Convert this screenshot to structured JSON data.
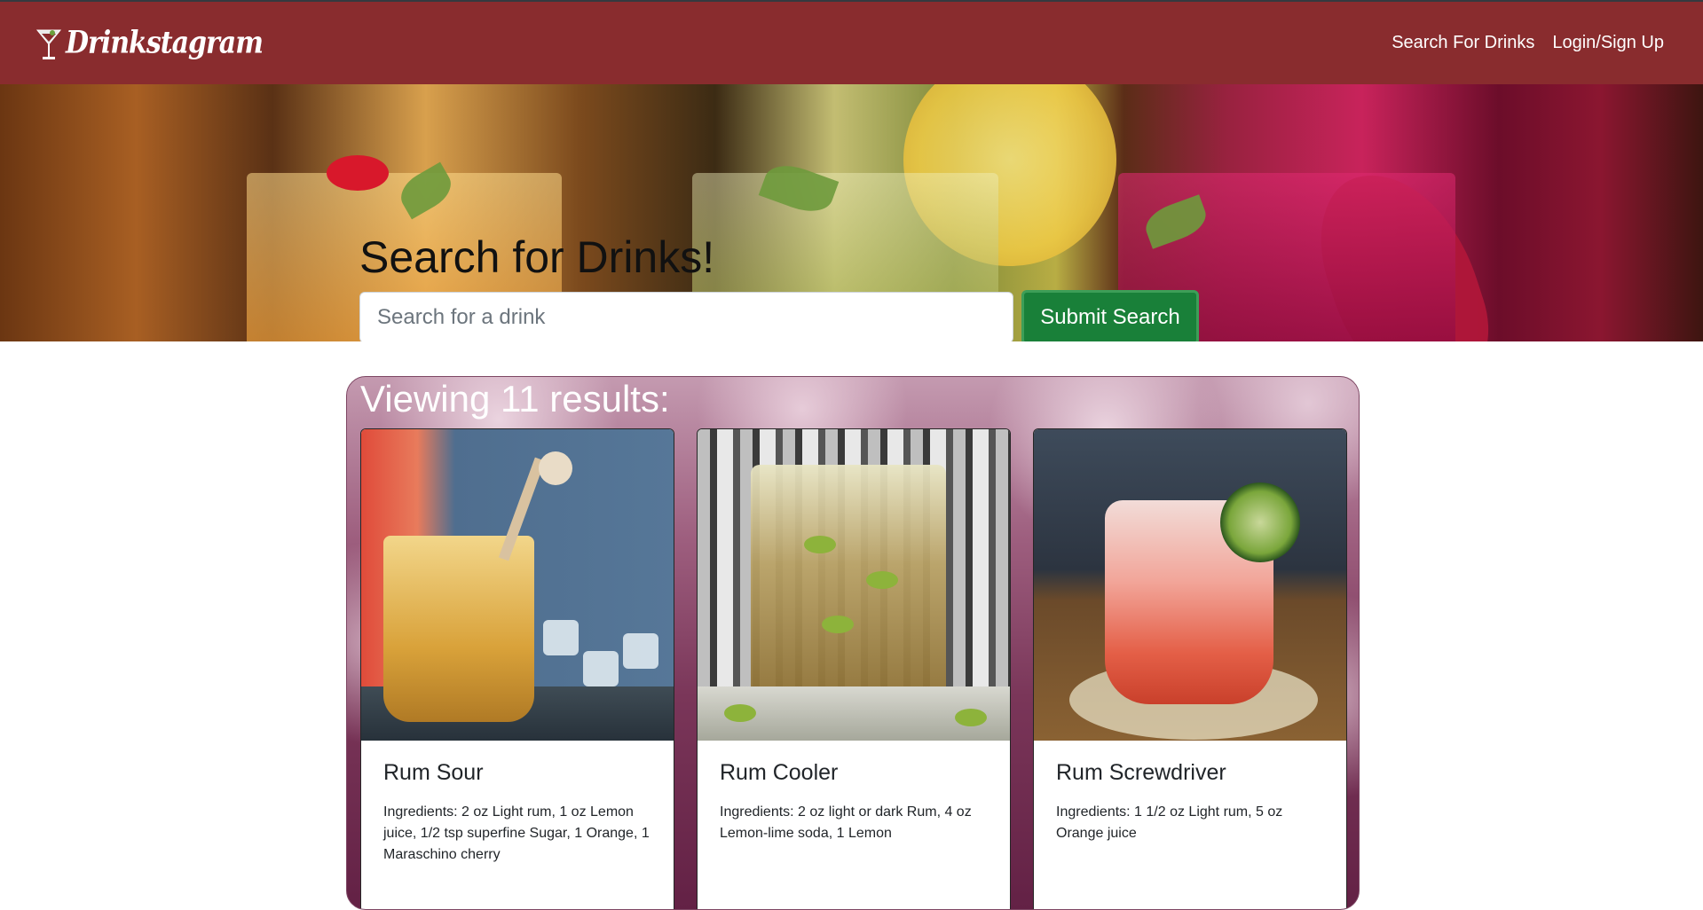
{
  "navbar": {
    "brand": "Drinkstagram",
    "links": [
      "Search For Drinks",
      "Login/Sign Up"
    ]
  },
  "search": {
    "title": "Search for Drinks!",
    "placeholder": "Search for a drink",
    "button": "Submit Search"
  },
  "results": {
    "title": "Viewing 11 results:",
    "cards": [
      {
        "name": "Rum Sour",
        "ingredients": "Ingredients: 2 oz Light rum, 1 oz Lemon juice, 1/2 tsp superfine Sugar, 1 Orange, 1 Maraschino cherry"
      },
      {
        "name": "Rum Cooler",
        "ingredients": "Ingredients: 2 oz light or dark Rum, 4 oz Lemon-lime soda, 1 Lemon"
      },
      {
        "name": "Rum Screwdriver",
        "ingredients": "Ingredients: 1 1/2 oz Light rum, 5 oz Orange juice"
      }
    ]
  },
  "colors": {
    "navbar": "#892c2e",
    "submit_button": "#198039"
  },
  "icons": {
    "brand_logo": "martini-glass-icon"
  }
}
